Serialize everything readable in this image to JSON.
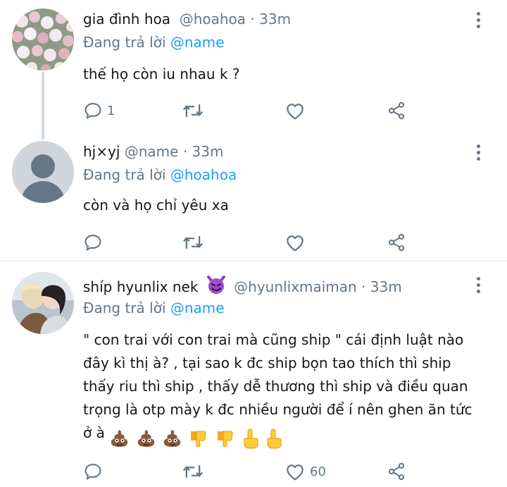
{
  "tweets": [
    {
      "name": "gia đình hoa",
      "handle": "@hoahoa",
      "separator": "·",
      "time": "33m",
      "reply_prefix": "Đang trả lời",
      "reply_mention": "@name",
      "text": "thế họ còn iu nhau k ?",
      "reply_count": "1",
      "retweet_count": "",
      "like_count": ""
    },
    {
      "name": "hj×yj",
      "handle": "@name",
      "separator": "·",
      "time": "33m",
      "reply_prefix": "Đang trả lời",
      "reply_mention": "@hoahoa",
      "text": "còn và họ chỉ yêu xa",
      "reply_count": "",
      "retweet_count": "",
      "like_count": ""
    },
    {
      "name": "shíp hyunlix nek",
      "handle": "@hyunlixmaiman",
      "separator": "·",
      "time": "33m",
      "reply_prefix": "Đang trả lời",
      "reply_mention": "@name",
      "text": "\" con trai với con trai mà cũng ship \" cái định luật nào đây kì thị à? ,  tại sao k đc ship bọn tao thích thì ship thấy riu thì ship ,  thấy dễ thương thì ship và điều quan trọng là otp mày k đc nhiều người để í nên ghen ăn tức ở à",
      "emojis": [
        "poo-emoji",
        "poo-emoji",
        "poo-emoji",
        "thumbs-down-emoji",
        "thumbs-down-emoji",
        "point-up-emoji",
        "point-up-emoji"
      ],
      "reply_count": "",
      "retweet_count": "",
      "like_count": "60"
    }
  ],
  "colors": {
    "link": "#1da1f2",
    "secondary": "#657786",
    "text": "#14171a",
    "divider": "#e1e8ed"
  }
}
